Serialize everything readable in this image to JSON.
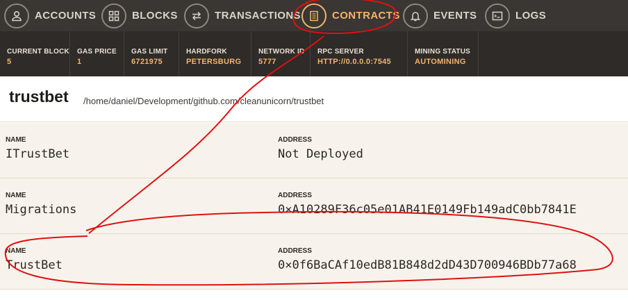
{
  "nav": {
    "items": [
      {
        "label": "ACCOUNTS",
        "icon": "account-icon"
      },
      {
        "label": "BLOCKS",
        "icon": "grid-icon"
      },
      {
        "label": "TRANSACTIONS",
        "icon": "transfer-arrows-icon"
      },
      {
        "label": "CONTRACTS",
        "icon": "document-icon",
        "active": true
      },
      {
        "label": "EVENTS",
        "icon": "bell-icon"
      },
      {
        "label": "LOGS",
        "icon": "terminal-icon"
      }
    ],
    "active_color": "#f1b56d"
  },
  "status": {
    "current_block": {
      "label": "CURRENT BLOCK",
      "value": "5"
    },
    "gas_price": {
      "label": "GAS PRICE",
      "value": "1"
    },
    "gas_limit": {
      "label": "GAS LIMIT",
      "value": "6721975"
    },
    "hardfork": {
      "label": "HARDFORK",
      "value": "PETERSBURG"
    },
    "network_id": {
      "label": "NETWORK ID",
      "value": "5777"
    },
    "rpc_server": {
      "label": "RPC SERVER",
      "value": "HTTP://0.0.0.0:7545"
    },
    "mining_status": {
      "label": "MINING STATUS",
      "value": "AUTOMINING"
    }
  },
  "project": {
    "title": "trustbet",
    "path": "/home/daniel/Development/github.com/cleanunicorn/trustbet"
  },
  "contracts": [
    {
      "name_label": "NAME",
      "name": "ITrustBet",
      "address_label": "ADDRESS",
      "address": "Not Deployed"
    },
    {
      "name_label": "NAME",
      "name": "Migrations",
      "address_label": "ADDRESS",
      "address": "0×A10289F36c05e01AB41E0149Fb149adC0bb7841E"
    },
    {
      "name_label": "NAME",
      "name": "TrustBet",
      "address_label": "ADDRESS",
      "address": "0×0f6BaCAf10edB81B848d2dD43D700946BDb77a68"
    }
  ],
  "annotation_color": "#e01010"
}
